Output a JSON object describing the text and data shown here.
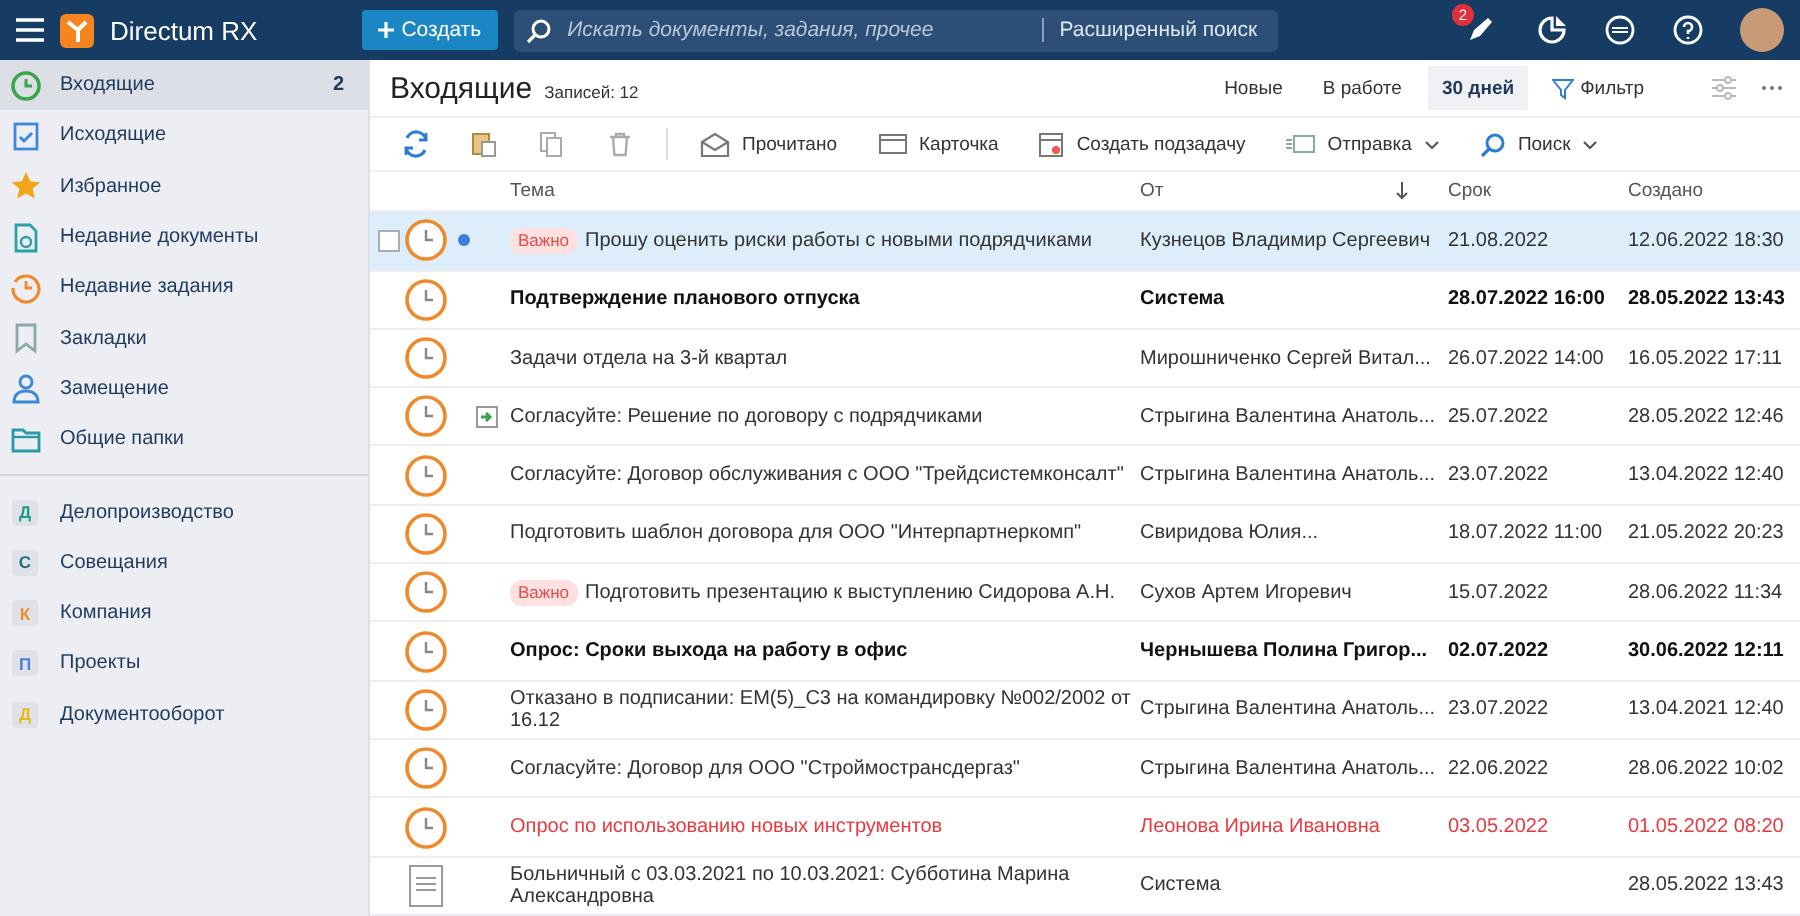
{
  "header": {
    "brand": "Directum RX",
    "create_button": "Создать",
    "search": {
      "placeholder": "Искать документы, задания, прочее"
    },
    "advanced_search": "Расширенный поиск",
    "notification_count": "2"
  },
  "sidebar": {
    "items": [
      {
        "kind": "inbox",
        "label": "Входящие",
        "count": "2",
        "selected": true
      },
      {
        "kind": "outbox",
        "label": "Исходящие",
        "selected": false
      },
      {
        "kind": "favorites",
        "label": "Избранное",
        "selected": false
      },
      {
        "kind": "recent-docs",
        "label": "Недавние документы",
        "selected": false
      },
      {
        "kind": "recent-tasks",
        "label": "Недавние задания",
        "selected": false
      },
      {
        "kind": "bookmarks",
        "label": "Закладки",
        "selected": false
      },
      {
        "kind": "substitution",
        "label": "Замещение",
        "selected": false
      },
      {
        "kind": "folders",
        "label": "Общие папки",
        "selected": false
      }
    ],
    "modules": [
      {
        "letter": "Д",
        "label": "Делопроизводство",
        "color": "#1f9a8a",
        "selected": false
      },
      {
        "letter": "С",
        "label": "Совещания",
        "color": "#1c6f78",
        "selected": false
      },
      {
        "letter": "К",
        "label": "Компания",
        "color": "#f08c2a",
        "selected": false
      },
      {
        "letter": "П",
        "label": "Проекты",
        "color": "#4a7fd6",
        "selected": false
      },
      {
        "letter": "Д",
        "label": "Документооборот",
        "color": "#e8b820",
        "selected": false
      }
    ]
  },
  "view": {
    "title": "Входящие",
    "records": "Записей: 12",
    "filters": [
      {
        "label": "Новые",
        "selected": false
      },
      {
        "label": "В работе",
        "selected": false
      },
      {
        "label": "30 дней",
        "selected": true
      }
    ],
    "filter_button": "Фильтр",
    "toolbar": [
      {
        "label": "Прочитано",
        "dropdown": false
      },
      {
        "label": "Карточка",
        "dropdown": false
      },
      {
        "label": "Создать подзадачу",
        "dropdown": false
      },
      {
        "label": "Отправка",
        "dropdown": true
      },
      {
        "label": "Поиск",
        "dropdown": true
      }
    ],
    "table": {
      "columns": [
        "Тема",
        "От",
        "Срок",
        "Создано"
      ],
      "rows": [
        {
          "kind": "task",
          "selected": true,
          "marked": true,
          "attachment": false,
          "tag": "Важно",
          "unread": false,
          "overdue": false,
          "subject": "Прошу оценить риски работы с новыми подрядчиками",
          "from": "Кузнецов Владимир Сергеевич",
          "due": "21.08.2022",
          "created": "12.06.2022 18:30"
        },
        {
          "kind": "task",
          "selected": false,
          "marked": false,
          "attachment": false,
          "unread": true,
          "overdue": false,
          "subject": "Подтверждение планового отпуска",
          "from": "Система",
          "due": "28.07.2022 16:00",
          "created": "28.05.2022 13:43"
        },
        {
          "kind": "task",
          "selected": false,
          "marked": false,
          "attachment": false,
          "unread": false,
          "overdue": false,
          "subject": "Задачи отдела на 3-й квартал",
          "from": "Мирошниченко Сергей Витал...",
          "due": "26.07.2022 14:00",
          "created": "16.05.2022 17:11"
        },
        {
          "kind": "task",
          "selected": false,
          "marked": false,
          "attachment": true,
          "unread": false,
          "overdue": false,
          "subject": "Согласуйте: Решение по договору с подрядчиками",
          "from": "Стрыгина Валентина Анатоль...",
          "due": "25.07.2022",
          "created": "28.05.2022 12:46"
        },
        {
          "kind": "task",
          "selected": false,
          "marked": false,
          "attachment": false,
          "unread": false,
          "overdue": false,
          "subject": "Согласуйте: Договор обслуживания с ООО \"Трейдсистемконсалт\"",
          "from": "Стрыгина Валентина Анатоль...",
          "due": "23.07.2022",
          "created": "13.04.2022 12:40"
        },
        {
          "kind": "task",
          "selected": false,
          "marked": false,
          "attachment": false,
          "unread": false,
          "overdue": false,
          "subject": "Подготовить шаблон договора для ООО \"Интерпартнеркомп\"",
          "from": "Свиридова Юлия...",
          "due": "18.07.2022 11:00",
          "created": "21.05.2022 20:23"
        },
        {
          "kind": "task",
          "selected": false,
          "marked": false,
          "attachment": false,
          "tag": "Важно",
          "unread": false,
          "overdue": false,
          "subject": "Подготовить презентацию к выступлению Сидорова А.Н.",
          "from": "Сухов Артем Игоревич",
          "due": "15.07.2022",
          "created": "28.06.2022 11:34"
        },
        {
          "kind": "task",
          "selected": false,
          "marked": false,
          "attachment": false,
          "unread": true,
          "overdue": false,
          "subject": "Опрос: Сроки выхода на работу в офис",
          "from": "Чернышева Полина Григор...",
          "due": "02.07.2022",
          "created": "30.06.2022 12:11"
        },
        {
          "kind": "task",
          "selected": false,
          "marked": false,
          "attachment": false,
          "unread": false,
          "overdue": false,
          "subject": "Отказано в подписании: ЕМ(5)_С3 на командировку №002/2002 от 16.12",
          "from": "Стрыгина Валентина Анатоль...",
          "due": "23.07.2022",
          "created": "13.04.2021 12:40"
        },
        {
          "kind": "task",
          "selected": false,
          "marked": false,
          "attachment": false,
          "unread": false,
          "overdue": false,
          "subject": "Согласуйте: Договор для ООО \"Строймострансдергаз\"",
          "from": "Стрыгина Валентина Анатоль...",
          "due": "22.06.2022",
          "created": "28.06.2022 10:02"
        },
        {
          "kind": "task",
          "selected": false,
          "marked": false,
          "attachment": false,
          "unread": false,
          "overdue": true,
          "subject": "Опрос по использованию новых инструментов",
          "from": "Леонова Ирина Ивановна",
          "due": "03.05.2022",
          "created": "01.05.2022 08:20"
        },
        {
          "kind": "document",
          "selected": false,
          "marked": false,
          "attachment": false,
          "unread": false,
          "overdue": false,
          "subject": "Больничный с 03.03.2021 по 10.03.2021: Субботина Марина Александровна",
          "from": "Система",
          "created": "28.05.2022 13:43"
        }
      ]
    }
  }
}
